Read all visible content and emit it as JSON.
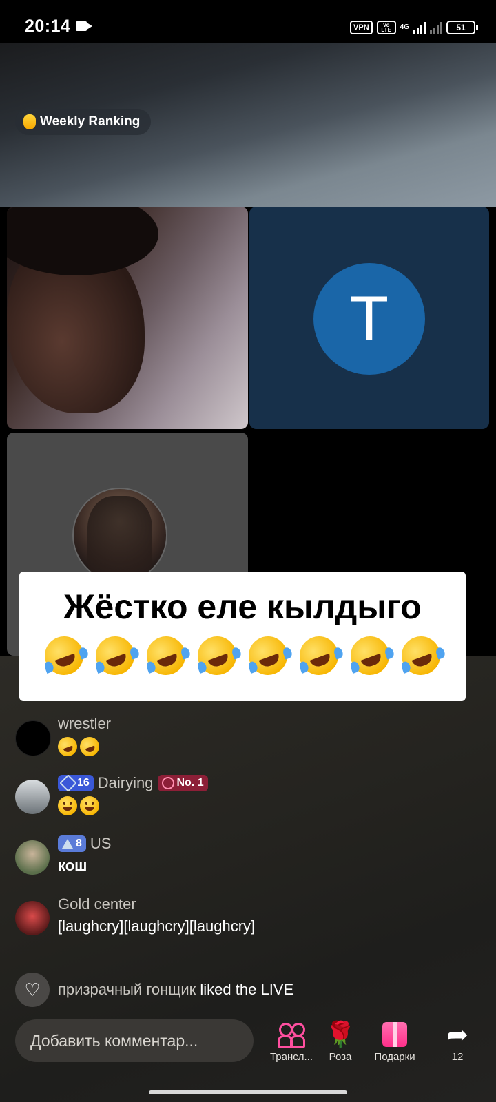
{
  "status_bar": {
    "time": "20:14",
    "vpn": "VPN",
    "volte": "Vo LTE",
    "network": "4G",
    "battery": "51"
  },
  "banner": {
    "ranking_label": "Weekly Ranking"
  },
  "guests": {
    "tile2_initial": "T"
  },
  "caption": {
    "text": "Жёстко еле кылдыго",
    "emoji_count": 8
  },
  "chat": [
    {
      "username": "wrestler",
      "message": "🤣🤣",
      "level": null,
      "badge": null
    },
    {
      "username": "Dairying",
      "message": "😀😀",
      "level": "16",
      "badge": "No. 1"
    },
    {
      "username": "US",
      "message": "кош",
      "level": "8",
      "badge": null
    },
    {
      "username": "Gold center",
      "message": "[laughcry][laughcry][laughcry]",
      "level": null,
      "badge": null
    }
  ],
  "liked": {
    "user": "призрачный гонщик",
    "text": "liked the LIVE"
  },
  "bottom_bar": {
    "comment_placeholder": "Добавить комментар...",
    "actions": [
      {
        "label": "Трансл...",
        "icon": "people-icon"
      },
      {
        "label": "Роза",
        "icon": "rose-icon"
      },
      {
        "label": "Подарки",
        "icon": "gift-icon"
      },
      {
        "label": "12",
        "icon": "share-icon"
      }
    ]
  },
  "colors": {
    "accent_pink": "#ff2f8a",
    "level_blue": "#3a58d8",
    "badge_red": "#8c1f37",
    "avatar_blue": "#1a66a8"
  }
}
